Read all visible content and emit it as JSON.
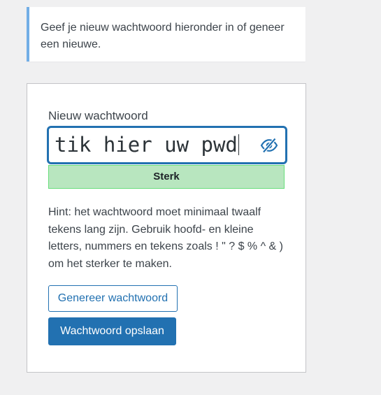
{
  "notice": {
    "text": "Geef je nieuw wachtwoord hieronder in of geneer een nieuwe."
  },
  "form": {
    "password_label": "Nieuw wachtwoord",
    "password_value": "tik hier uw pwd",
    "toggle_icon": "eye-slash-icon",
    "strength_label": "Sterk",
    "strength_color": "#b8e6bf",
    "hint": "Hint: het wachtwoord moet minimaal twaalf tekens lang zijn. Gebruik hoofd- en kleine letters, nummers en tekens zoals ! \" ? $ % ^ & ) om het sterker te maken.",
    "generate_button": "Genereer wachtwoord",
    "save_button": "Wachtwoord opslaan"
  },
  "colors": {
    "accent": "#2271b1",
    "notice_border": "#72aee6",
    "background": "#f0f0f1"
  }
}
